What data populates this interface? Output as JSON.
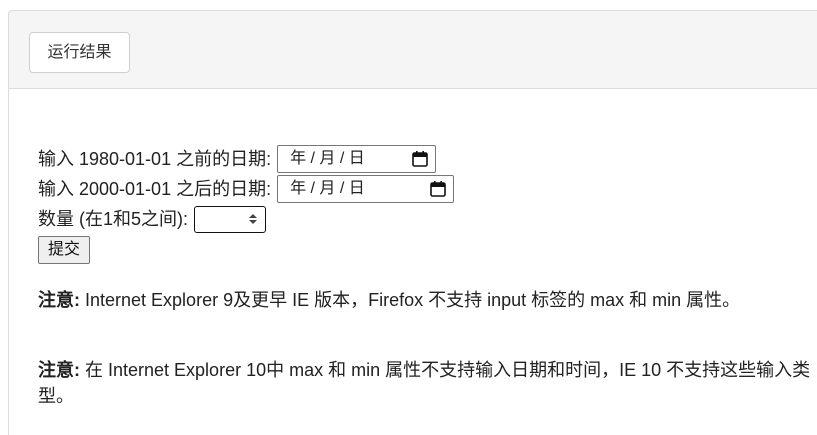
{
  "tab": {
    "label": "运行结果"
  },
  "form": {
    "date_before": {
      "label": "输入 1980-01-01 之前的日期:",
      "value": "年 / 月 / 日"
    },
    "date_after": {
      "label": "输入 2000-01-01 之后的日期:",
      "value": "年 / 月 / 日"
    },
    "quantity": {
      "label": "数量 (在1和5之间):",
      "value": ""
    },
    "submit_label": "提交"
  },
  "notes": [
    {
      "strong": "注意:",
      "text": " Internet Explorer 9及更早 IE 版本，Firefox 不支持 input 标签的 max 和 min 属性。"
    },
    {
      "strong": "注意:",
      "text": " 在 Internet Explorer 10中 max 和 min 属性不支持输入日期和时间，IE 10 不支持这些输入类型。"
    }
  ],
  "icons": {
    "date_picker": "calendar-icon",
    "spinner": "spin-arrows-icon"
  }
}
